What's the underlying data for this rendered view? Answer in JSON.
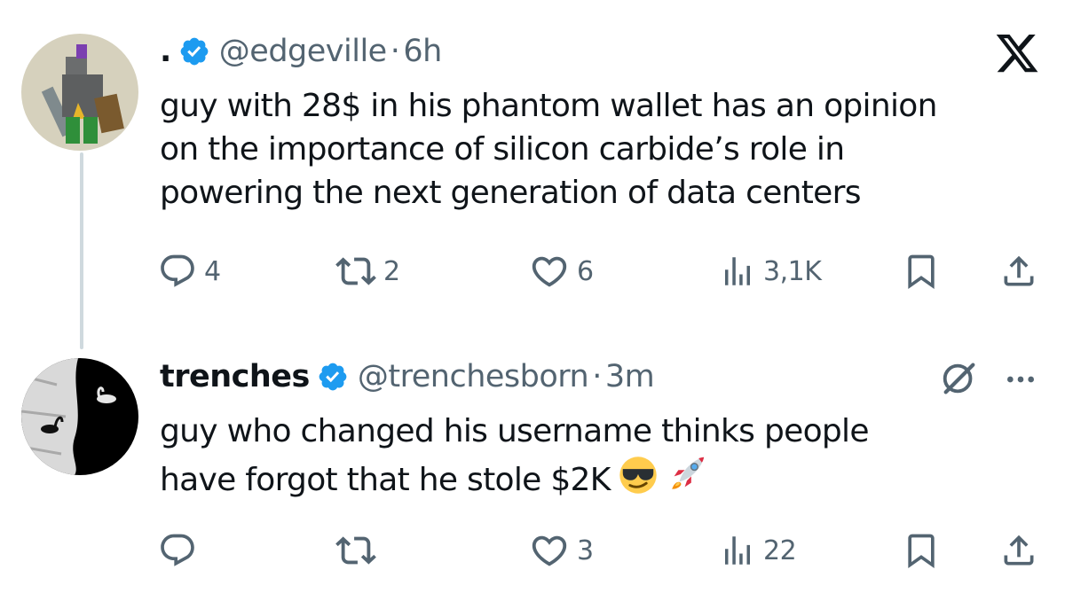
{
  "tweets": [
    {
      "name": ".",
      "handle": "@edgeville",
      "separator": "·",
      "time": "6h",
      "text": "guy with 28$ in his phantom wallet has an opinion\non the importance of silicon carbide’s role in\npowering the next generation of data centers",
      "avatar": "pixel-knight-avatar",
      "corner_icon": "x-logo-icon",
      "actions": {
        "replies": "4",
        "reposts": "2",
        "likes": "6",
        "views": "3,1K"
      }
    },
    {
      "name": "trenches",
      "handle": "@trenchesborn",
      "separator": "·",
      "time": "3m",
      "text": "guy who changed his username thinks people\nhave forgot that he stole $2K",
      "emojis": [
        "sunglasses-emoji",
        "rocket-emoji"
      ],
      "avatar": "swan-lake-avatar",
      "corner_icons": [
        "grok-icon",
        "more-icon"
      ],
      "actions": {
        "replies": "",
        "reposts": "",
        "likes": "3",
        "views": "22"
      }
    }
  ],
  "colors": {
    "text": "#0f1419",
    "secondary": "#536471",
    "verified": "#1d9bf0",
    "thread_line": "#cfd9de"
  }
}
